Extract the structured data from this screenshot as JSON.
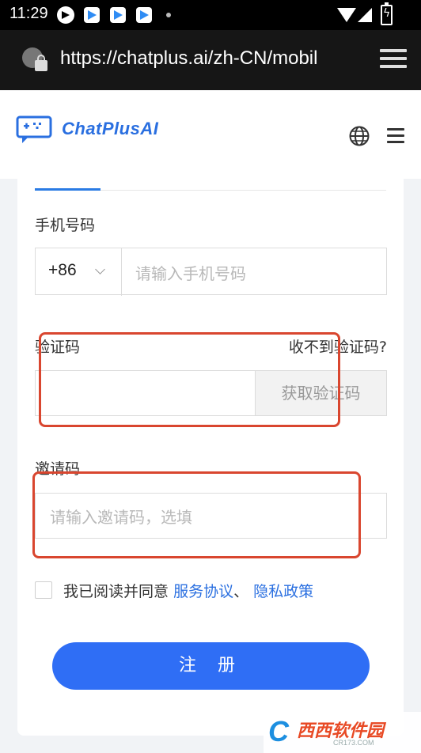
{
  "status_bar": {
    "time": "11:29"
  },
  "browser": {
    "url": "https://chatplus.ai/zh-CN/mobil"
  },
  "header": {
    "logo_text": "ChatPlusAI"
  },
  "form": {
    "phone_label": "手机号码",
    "country_code": "+86",
    "phone_placeholder": "请输入手机号码",
    "code_label": "验证码",
    "code_help": "收不到验证码?",
    "get_code_button": "获取验证码",
    "invite_label": "邀请码",
    "invite_placeholder": "请输入邀请码，选填",
    "agree_prefix": "我已阅读并同意",
    "terms_link": "服务协议",
    "separator": "、",
    "privacy_link": "隐私政策",
    "submit": "注 册"
  },
  "watermark": {
    "brand": "西西软件园",
    "url": "CR173.COM"
  },
  "colors": {
    "accent": "#2f6ef5",
    "link": "#2a6fe0",
    "highlight": "#d9462f"
  }
}
